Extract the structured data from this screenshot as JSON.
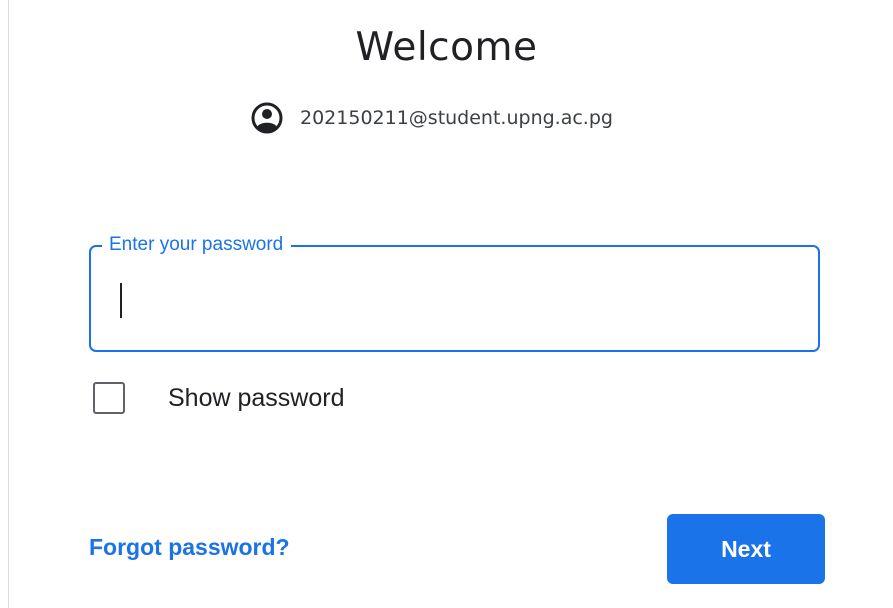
{
  "header": {
    "title": "Welcome"
  },
  "account": {
    "icon": "account-circle-icon",
    "email": "202150211@student.upng.ac.pg"
  },
  "password_field": {
    "label": "Enter your password",
    "value": ""
  },
  "show_password": {
    "label": "Show password",
    "checked": false
  },
  "actions": {
    "forgot_label": "Forgot password?",
    "next_label": "Next"
  },
  "colors": {
    "accent": "#1a73e8",
    "text": "#202124",
    "secondary_text": "#3c4043",
    "checkbox_border": "#5f6368"
  }
}
